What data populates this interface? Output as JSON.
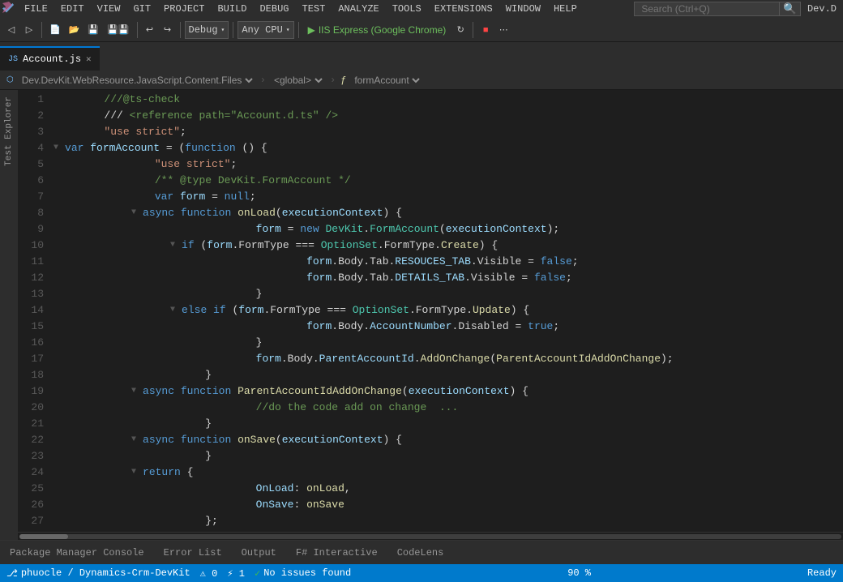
{
  "app": {
    "title": "Dev.D"
  },
  "menubar": {
    "logo_icon": "vs-icon",
    "items": [
      "FILE",
      "EDIT",
      "VIEW",
      "GIT",
      "PROJECT",
      "BUILD",
      "DEBUG",
      "TEST",
      "ANALYZE",
      "TOOLS",
      "EXTENSIONS",
      "WINDOW",
      "HELP"
    ],
    "search_placeholder": "Search (Ctrl+Q)",
    "user": "Dev.D"
  },
  "toolbar": {
    "debug_config": "Debug",
    "cpu_config": "Any CPU",
    "run_label": "IIS Express (Google Chrome)",
    "refresh_icon": "refresh-icon",
    "dropdown_arrow": "▾"
  },
  "tabs": [
    {
      "name": "Account.js",
      "active": true,
      "modified": false,
      "icon": "js-icon"
    }
  ],
  "breadcrumb": {
    "project": "Dev.DevKit.WebResource.JavaScript.Content.Files",
    "scope": "<global>",
    "symbol": "formAccount"
  },
  "code": {
    "lines": [
      {
        "num": 1,
        "indent": 0,
        "tokens": [
          {
            "text": "\t///@ts-check",
            "cls": "c-comment"
          }
        ]
      },
      {
        "num": 2,
        "indent": 0,
        "tokens": [
          {
            "text": "\t/// ",
            "cls": ""
          },
          {
            "text": "<reference path=\"Account.d.ts\" />",
            "cls": "c-comment"
          }
        ]
      },
      {
        "num": 3,
        "indent": 0,
        "tokens": [
          {
            "text": "\t",
            "cls": ""
          },
          {
            "text": "\"use strict\"",
            "cls": "c-string"
          },
          {
            "text": ";",
            "cls": ""
          }
        ]
      },
      {
        "num": 4,
        "indent": 0,
        "tokens": [
          {
            "text": "▼ ",
            "cls": "c-collapse"
          },
          {
            "text": "var ",
            "cls": "c-keyword"
          },
          {
            "text": "formAccount",
            "cls": "c-param"
          },
          {
            "text": " = (",
            "cls": ""
          },
          {
            "text": "function ",
            "cls": "c-keyword"
          },
          {
            "text": "() {",
            "cls": ""
          }
        ]
      },
      {
        "num": 5,
        "indent": 1,
        "tokens": [
          {
            "text": "\t\t",
            "cls": ""
          },
          {
            "text": "\"use strict\"",
            "cls": "c-string"
          },
          {
            "text": ";",
            "cls": ""
          }
        ]
      },
      {
        "num": 6,
        "indent": 1,
        "tokens": [
          {
            "text": "\t\t",
            "cls": ""
          },
          {
            "text": "/** ",
            "cls": "c-comment"
          },
          {
            "text": "@type",
            "cls": "c-comment"
          },
          {
            "text": " DevKit.FormAccount ",
            "cls": "c-comment"
          },
          {
            "text": "*/",
            "cls": "c-comment"
          }
        ]
      },
      {
        "num": 7,
        "indent": 1,
        "tokens": [
          {
            "text": "\t\t",
            "cls": ""
          },
          {
            "text": "var ",
            "cls": "c-keyword"
          },
          {
            "text": "form",
            "cls": "c-param"
          },
          {
            "text": " = ",
            "cls": ""
          },
          {
            "text": "null",
            "cls": "c-keyword"
          },
          {
            "text": ";",
            "cls": ""
          }
        ]
      },
      {
        "num": 8,
        "indent": 1,
        "tokens": [
          {
            "text": "\t\t▼ ",
            "cls": "c-collapse"
          },
          {
            "text": "async ",
            "cls": "c-keyword"
          },
          {
            "text": "function ",
            "cls": "c-keyword"
          },
          {
            "text": "onLoad",
            "cls": "c-func"
          },
          {
            "text": "(",
            "cls": ""
          },
          {
            "text": "executionContext",
            "cls": "c-param"
          },
          {
            "text": ") {",
            "cls": ""
          }
        ]
      },
      {
        "num": 9,
        "indent": 2,
        "tokens": [
          {
            "text": "\t\t\t\t",
            "cls": ""
          },
          {
            "text": "form",
            "cls": "c-param"
          },
          {
            "text": " = ",
            "cls": ""
          },
          {
            "text": "new ",
            "cls": "c-keyword"
          },
          {
            "text": "DevKit",
            "cls": "c-class"
          },
          {
            "text": ".",
            "cls": ""
          },
          {
            "text": "FormAccount",
            "cls": "c-class"
          },
          {
            "text": "(",
            "cls": ""
          },
          {
            "text": "executionContext",
            "cls": "c-param"
          },
          {
            "text": ");",
            "cls": ""
          }
        ]
      },
      {
        "num": 10,
        "indent": 2,
        "tokens": [
          {
            "text": "\t\t\t▼ ",
            "cls": "c-collapse"
          },
          {
            "text": "if ",
            "cls": "c-keyword"
          },
          {
            "text": "(",
            "cls": ""
          },
          {
            "text": "form",
            "cls": "c-param"
          },
          {
            "text": ".FormType === ",
            "cls": ""
          },
          {
            "text": "OptionSet",
            "cls": "c-class"
          },
          {
            "text": ".FormType.",
            "cls": ""
          },
          {
            "text": "Create",
            "cls": "c-func"
          },
          {
            "text": ") {",
            "cls": ""
          }
        ]
      },
      {
        "num": 11,
        "indent": 3,
        "tokens": [
          {
            "text": "\t\t\t\t\t",
            "cls": ""
          },
          {
            "text": "form",
            "cls": "c-param"
          },
          {
            "text": ".Body.Tab.",
            "cls": ""
          },
          {
            "text": "RESOUCES_TAB",
            "cls": "c-param"
          },
          {
            "text": ".Visible = ",
            "cls": ""
          },
          {
            "text": "false",
            "cls": "c-bool"
          },
          {
            "text": ";",
            "cls": ""
          }
        ]
      },
      {
        "num": 12,
        "indent": 3,
        "tokens": [
          {
            "text": "\t\t\t\t\t",
            "cls": ""
          },
          {
            "text": "form",
            "cls": "c-param"
          },
          {
            "text": ".Body.Tab.",
            "cls": ""
          },
          {
            "text": "DETAILS_TAB",
            "cls": "c-param"
          },
          {
            "text": ".Visible = ",
            "cls": ""
          },
          {
            "text": "false",
            "cls": "c-bool"
          },
          {
            "text": ";",
            "cls": ""
          }
        ]
      },
      {
        "num": 13,
        "indent": 3,
        "tokens": [
          {
            "text": "\t\t\t\t}",
            "cls": ""
          }
        ]
      },
      {
        "num": 14,
        "indent": 2,
        "tokens": [
          {
            "text": "\t\t\t▼ ",
            "cls": "c-collapse"
          },
          {
            "text": "else if ",
            "cls": "c-keyword"
          },
          {
            "text": "(",
            "cls": ""
          },
          {
            "text": "form",
            "cls": "c-param"
          },
          {
            "text": ".FormType === ",
            "cls": ""
          },
          {
            "text": "OptionSet",
            "cls": "c-class"
          },
          {
            "text": ".FormType.",
            "cls": ""
          },
          {
            "text": "Update",
            "cls": "c-func"
          },
          {
            "text": ") {",
            "cls": ""
          }
        ]
      },
      {
        "num": 15,
        "indent": 3,
        "tokens": [
          {
            "text": "\t\t\t\t\t",
            "cls": ""
          },
          {
            "text": "form",
            "cls": "c-param"
          },
          {
            "text": ".Body.",
            "cls": ""
          },
          {
            "text": "AccountNumber",
            "cls": "c-param"
          },
          {
            "text": ".Disabled = ",
            "cls": ""
          },
          {
            "text": "true",
            "cls": "c-bool"
          },
          {
            "text": ";",
            "cls": ""
          }
        ]
      },
      {
        "num": 16,
        "indent": 3,
        "tokens": [
          {
            "text": "\t\t\t\t}",
            "cls": ""
          }
        ]
      },
      {
        "num": 17,
        "indent": 2,
        "tokens": [
          {
            "text": "\t\t\t\t",
            "cls": ""
          },
          {
            "text": "form",
            "cls": "c-param"
          },
          {
            "text": ".Body.",
            "cls": ""
          },
          {
            "text": "ParentAccountId",
            "cls": "c-param"
          },
          {
            "text": ".",
            "cls": ""
          },
          {
            "text": "AddOnChange",
            "cls": "c-func"
          },
          {
            "text": "(",
            "cls": ""
          },
          {
            "text": "ParentAccountIdAddOnChange",
            "cls": "c-func"
          },
          {
            "text": ");",
            "cls": ""
          }
        ]
      },
      {
        "num": 18,
        "indent": 2,
        "tokens": [
          {
            "text": "\t\t\t}",
            "cls": ""
          }
        ]
      },
      {
        "num": 19,
        "indent": 1,
        "tokens": [
          {
            "text": "\t\t▼ ",
            "cls": "c-collapse"
          },
          {
            "text": "async ",
            "cls": "c-keyword"
          },
          {
            "text": "function ",
            "cls": "c-keyword"
          },
          {
            "text": "ParentAccountIdAddOnChange",
            "cls": "c-func"
          },
          {
            "text": "(",
            "cls": ""
          },
          {
            "text": "executionContext",
            "cls": "c-param"
          },
          {
            "text": ") {",
            "cls": ""
          }
        ]
      },
      {
        "num": 20,
        "indent": 2,
        "tokens": [
          {
            "text": "\t\t\t\t",
            "cls": ""
          },
          {
            "text": "//do the code add on change  ...",
            "cls": "c-comment"
          }
        ]
      },
      {
        "num": 21,
        "indent": 2,
        "tokens": [
          {
            "text": "\t\t\t}",
            "cls": ""
          }
        ]
      },
      {
        "num": 22,
        "indent": 1,
        "tokens": [
          {
            "text": "\t\t▼ ",
            "cls": "c-collapse"
          },
          {
            "text": "async ",
            "cls": "c-keyword"
          },
          {
            "text": "function ",
            "cls": "c-keyword"
          },
          {
            "text": "onSave",
            "cls": "c-func"
          },
          {
            "text": "(",
            "cls": ""
          },
          {
            "text": "executionContext",
            "cls": "c-param"
          },
          {
            "text": ") {",
            "cls": ""
          }
        ]
      },
      {
        "num": 23,
        "indent": 2,
        "tokens": [
          {
            "text": "\t\t\t}",
            "cls": ""
          }
        ]
      },
      {
        "num": 24,
        "indent": 1,
        "tokens": [
          {
            "text": "\t\t▼ ",
            "cls": "c-collapse"
          },
          {
            "text": "return ",
            "cls": "c-keyword"
          },
          {
            "text": "{",
            "cls": ""
          }
        ]
      },
      {
        "num": 25,
        "indent": 2,
        "tokens": [
          {
            "text": "\t\t\t\t",
            "cls": ""
          },
          {
            "text": "OnLoad",
            "cls": "c-param"
          },
          {
            "text": ": ",
            "cls": ""
          },
          {
            "text": "onLoad",
            "cls": "c-func"
          },
          {
            "text": ",",
            "cls": ""
          }
        ]
      },
      {
        "num": 26,
        "indent": 2,
        "tokens": [
          {
            "text": "\t\t\t\t",
            "cls": ""
          },
          {
            "text": "OnSave",
            "cls": "c-param"
          },
          {
            "text": ": ",
            "cls": ""
          },
          {
            "text": "onSave",
            "cls": "c-func"
          }
        ]
      },
      {
        "num": 27,
        "indent": 2,
        "tokens": [
          {
            "text": "\t\t\t};",
            "cls": ""
          }
        ]
      }
    ]
  },
  "statusbar": {
    "zoom": "90 %",
    "no_issues": "No issues found",
    "git_user": "phuocle / Dynamics-Crm-DevKit",
    "errors": "⚠ 0",
    "warnings": "⚡ 1",
    "ready": "Ready"
  },
  "bottom_tabs": [
    {
      "label": "Package Manager Console",
      "active": false
    },
    {
      "label": "Error List",
      "active": false
    },
    {
      "label": "Output",
      "active": false
    },
    {
      "label": "F# Interactive",
      "active": false
    },
    {
      "label": "CodeLens",
      "active": false
    }
  ],
  "side_tabs": [
    "Test Explorer"
  ]
}
